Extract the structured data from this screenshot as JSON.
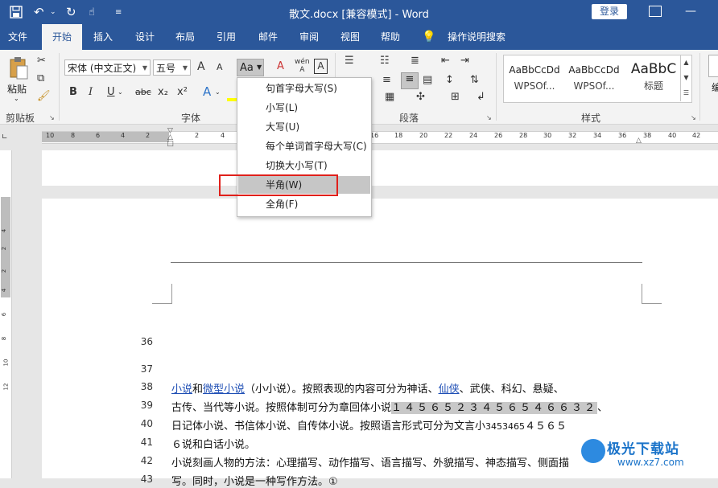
{
  "window": {
    "title": "散文.docx [兼容模式] - Word",
    "login_label": "登录"
  },
  "tabs": [
    "文件",
    "开始",
    "插入",
    "设计",
    "布局",
    "引用",
    "邮件",
    "审阅",
    "视图",
    "帮助",
    "操作说明搜索"
  ],
  "active_tab": "开始",
  "ribbon": {
    "clipboard": {
      "paste_label": "粘贴",
      "group_label": "剪贴板"
    },
    "font": {
      "font_name": "宋体 (中文正文)",
      "font_size": "五号",
      "change_case_label": "Aa",
      "group_label": "字体",
      "bold": "B",
      "italic": "I",
      "underline": "U",
      "strike": "abc",
      "subscript": "x₂",
      "superscript": "x²",
      "grow": "A",
      "shrink": "A",
      "clear": "A",
      "phonetic": "wén",
      "border": "A"
    },
    "paragraph": {
      "group_label": "段落"
    },
    "styles": {
      "group_label": "样式",
      "items": [
        {
          "preview": "AaBbCcDd",
          "name": "WPSOf..."
        },
        {
          "preview": "AaBbCcDd",
          "name": "WPSOf..."
        },
        {
          "preview": "AaBbC",
          "name": "标题"
        }
      ]
    },
    "editing_label": "编"
  },
  "case_menu": {
    "items": [
      "句首字母大写(S)",
      "小写(L)",
      "大写(U)",
      "每个单词首字母大写(C)",
      "切换大小写(T)",
      "半角(W)",
      "全角(F)"
    ],
    "highlighted": "半角(W)"
  },
  "ruler": {
    "ticks": [
      "10",
      "8",
      "6",
      "4",
      "2",
      "2",
      "4",
      "6",
      "8",
      "10",
      "12",
      "14",
      "16",
      "18",
      "20",
      "22",
      "24",
      "26",
      "28",
      "30",
      "32",
      "34",
      "36",
      "38",
      "40",
      "42"
    ],
    "vertical_ticks": [
      "4",
      "2",
      "2",
      "4",
      "6",
      "8",
      "10",
      "12"
    ]
  },
  "document": {
    "lines": [
      {
        "num": "36",
        "text": ""
      },
      {
        "num": "37",
        "text": ""
      },
      {
        "num": "38",
        "parts": [
          {
            "t": "小说",
            "link": true
          },
          {
            "t": "和"
          },
          {
            "t": "微型小说",
            "link": true
          },
          {
            "t": "（小小说）。按照表现的内容可分为神话、"
          },
          {
            "t": "仙侠",
            "link": true
          },
          {
            "t": "、武侠、科幻、悬疑、"
          }
        ]
      },
      {
        "num": "39",
        "parts": [
          {
            "t": "古传、当代等小说。按照体制可分为章回体小说"
          },
          {
            "t": "１４５６５２３４５６５４６６３２",
            "hl": true
          },
          {
            "t": "、"
          }
        ]
      },
      {
        "num": "40",
        "parts": [
          {
            "t": "日记体小说、书信体小说、自传体小说。按照语言形式可分为文言小"
          },
          {
            "t": "3453465",
            "small": true
          },
          {
            "t": "４５６５"
          }
        ]
      },
      {
        "num": "41",
        "parts": [
          {
            "t": "６说和白话小说。"
          }
        ]
      },
      {
        "num": "42",
        "parts": [
          {
            "t": "小说刻画人物的方法：心理描写、动作描写、语言描写、外貌描写、神态描写、侧面描"
          }
        ]
      },
      {
        "num": "43",
        "parts": [
          {
            "t": "写。同时，小说是一种写作方法。①"
          }
        ]
      }
    ]
  },
  "watermark": {
    "title": "极光下载站",
    "url": "www.xz7.com"
  },
  "colors": {
    "accent": "#2b579a",
    "highlight_box": "#e0201b",
    "menu_hover": "#c6c6c6",
    "link": "#1f4fb5"
  }
}
